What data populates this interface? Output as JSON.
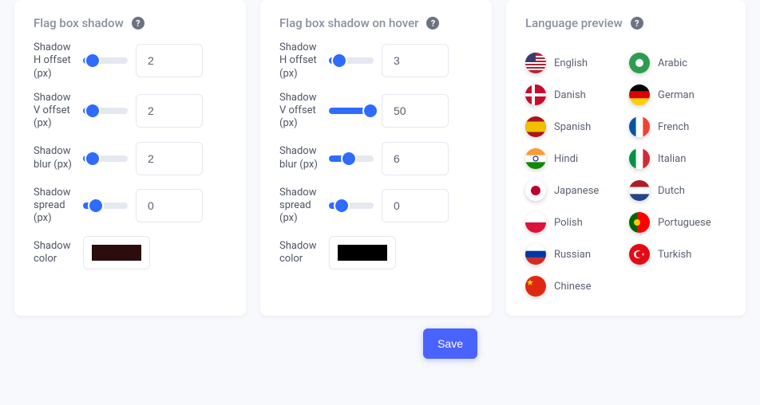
{
  "shadow": {
    "title": "Flag box shadow",
    "h_offset": {
      "label": "Shadow H offset (px)",
      "value": "2",
      "pct": 22
    },
    "v_offset": {
      "label": "Shadow V offset (px)",
      "value": "2",
      "pct": 22
    },
    "blur": {
      "label": "Shadow blur (px)",
      "value": "2",
      "pct": 22
    },
    "spread": {
      "label": "Shadow spread (px)",
      "value": "0",
      "pct": 28
    },
    "color": {
      "label": "Shadow color",
      "value": "#2a0d0c"
    }
  },
  "shadow_hover": {
    "title": "Flag box shadow on hover",
    "h_offset": {
      "label": "Shadow H offset (px)",
      "value": "3",
      "pct": 24
    },
    "v_offset": {
      "label": "Shadow V offset (px)",
      "value": "50",
      "pct": 92
    },
    "blur": {
      "label": "Shadow blur (px)",
      "value": "6",
      "pct": 44
    },
    "spread": {
      "label": "Shadow spread (px)",
      "value": "0",
      "pct": 28
    },
    "color": {
      "label": "Shadow color",
      "value": "#000000"
    }
  },
  "preview": {
    "title": "Language preview",
    "languages": [
      {
        "name": "English",
        "flag": "us"
      },
      {
        "name": "Arabic",
        "flag": "ar"
      },
      {
        "name": "Danish",
        "flag": "dk"
      },
      {
        "name": "German",
        "flag": "de"
      },
      {
        "name": "Spanish",
        "flag": "es"
      },
      {
        "name": "French",
        "flag": "fr"
      },
      {
        "name": "Hindi",
        "flag": "in"
      },
      {
        "name": "Italian",
        "flag": "it"
      },
      {
        "name": "Japanese",
        "flag": "jp"
      },
      {
        "name": "Dutch",
        "flag": "nl"
      },
      {
        "name": "Polish",
        "flag": "pl"
      },
      {
        "name": "Portuguese",
        "flag": "pt"
      },
      {
        "name": "Russian",
        "flag": "ru"
      },
      {
        "name": "Turkish",
        "flag": "tr"
      },
      {
        "name": "Chinese",
        "flag": "cn"
      }
    ]
  },
  "actions": {
    "save": "Save"
  }
}
